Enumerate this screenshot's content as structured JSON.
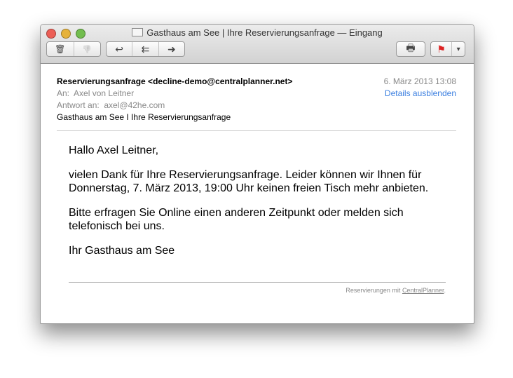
{
  "window": {
    "title": "Gasthaus am See | Ihre Reservierungsanfrage — Eingang"
  },
  "toolbar": {
    "delete": "🗑",
    "junk": "👎",
    "reply": "↩",
    "reply_all": "⇇",
    "forward": "➜",
    "print": "🖶",
    "flag": "⚑",
    "flag_menu": "▾"
  },
  "header": {
    "from": "Reservierungsanfrage <decline-demo@centralplanner.net>",
    "to_label": "An:",
    "to": "Axel von Leitner",
    "reply_to_label": "Antwort an:",
    "reply_to": "axel@42he.com",
    "subject": "Gasthaus am See I Ihre Reservierungsanfrage",
    "date": "6. März 2013 13:08",
    "details_link": "Details ausblenden"
  },
  "body": {
    "greeting": "Hallo Axel Leitner,",
    "p1": "vielen Dank für Ihre Reservierungsanfrage. Leider können wir Ihnen für Donnerstag, 7. März 2013, 19:00 Uhr keinen freien Tisch mehr anbieten.",
    "p2": "Bitte erfragen Sie Online einen anderen Zeitpunkt oder melden sich telefonisch bei uns.",
    "sign": "Ihr Gasthaus am See"
  },
  "footer": {
    "text": "Reservierungen mit ",
    "link": "CentralPlanner",
    "dot": "."
  },
  "colors": {
    "close": "#ec5f57",
    "min": "#e6b23a",
    "max": "#72bd4e",
    "link": "#3b7fe0"
  }
}
